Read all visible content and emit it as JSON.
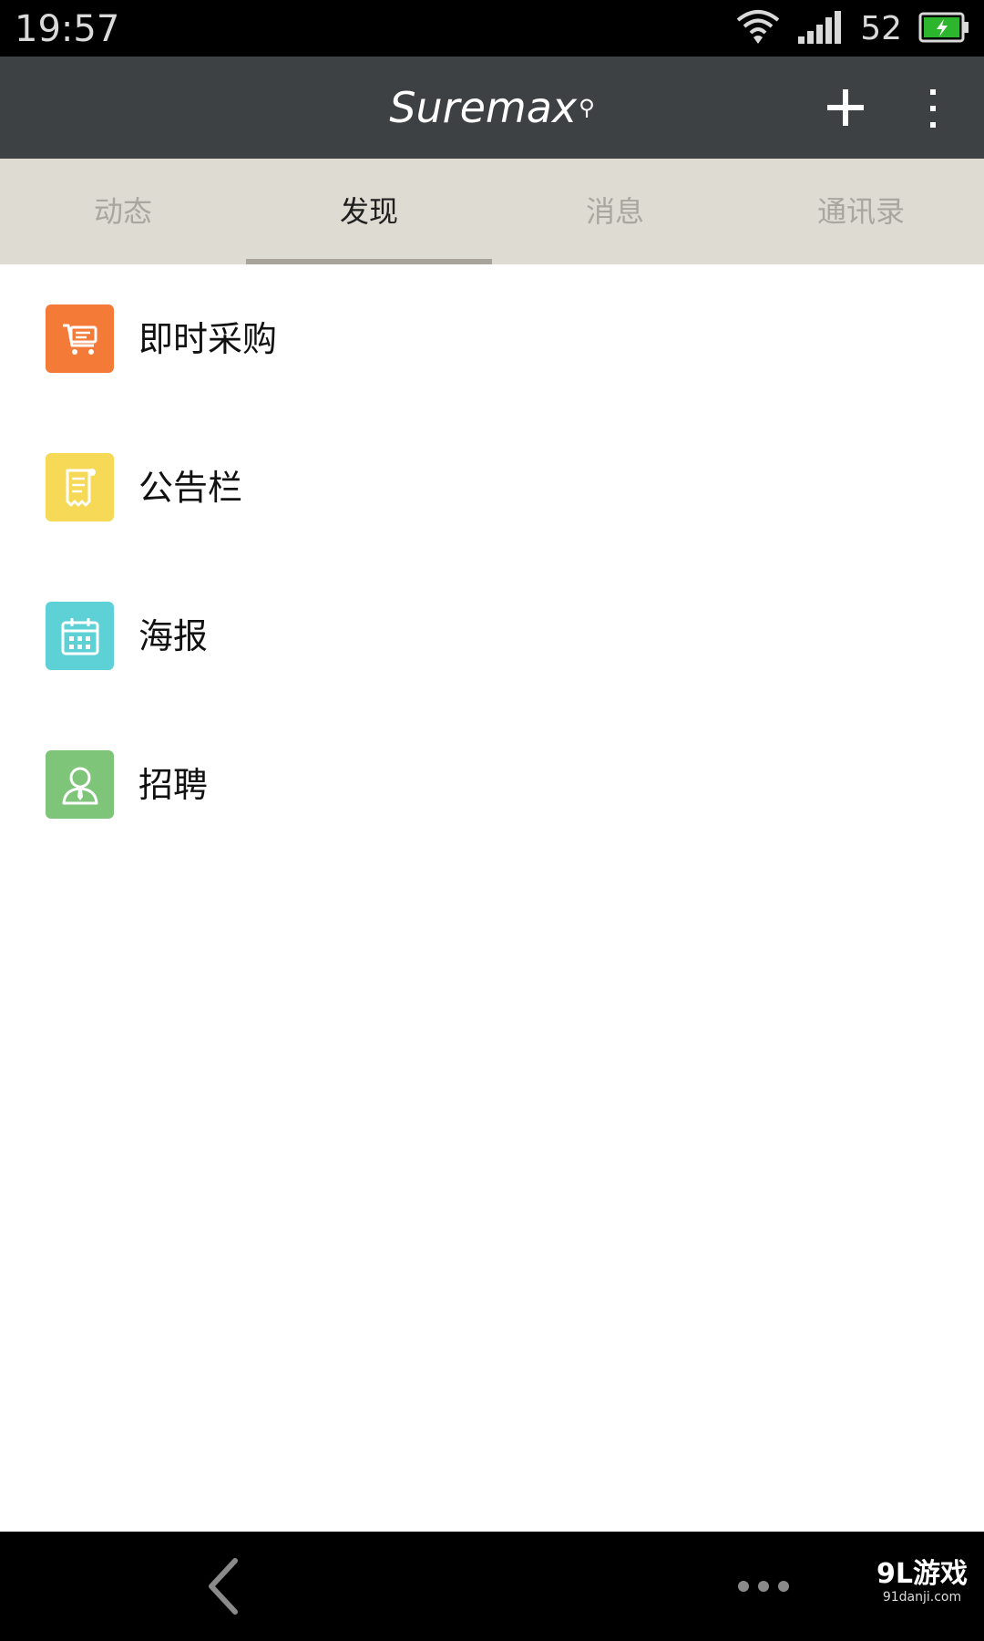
{
  "status_bar": {
    "time": "19:57",
    "battery_level": "52",
    "icons": [
      "wifi-icon",
      "signal-icon",
      "battery-charging-icon"
    ],
    "battery_color": "#2db52d"
  },
  "app_bar": {
    "title": "Suremax",
    "title_mark": "⚲",
    "actions": [
      "add-icon",
      "more-vert-icon"
    ],
    "background": "#3e4143"
  },
  "tabs": [
    {
      "label": "动态",
      "active": false
    },
    {
      "label": "发现",
      "active": true
    },
    {
      "label": "消息",
      "active": false
    },
    {
      "label": "通讯录",
      "active": false
    }
  ],
  "discover_items": [
    {
      "label": "即时采购",
      "icon": "shopping-cart-icon",
      "color": "#f47a38"
    },
    {
      "label": "公告栏",
      "icon": "bulletin-note-icon",
      "color": "#f5d957"
    },
    {
      "label": "海报",
      "icon": "calendar-icon",
      "color": "#5ed1d6"
    },
    {
      "label": "招聘",
      "icon": "person-icon",
      "color": "#7ec57a"
    }
  ],
  "bottom_bar": {
    "icons": [
      "back-icon",
      "menu-dots-icon"
    ],
    "watermark_main": "9L游戏",
    "watermark_sub": "91danji.com"
  }
}
